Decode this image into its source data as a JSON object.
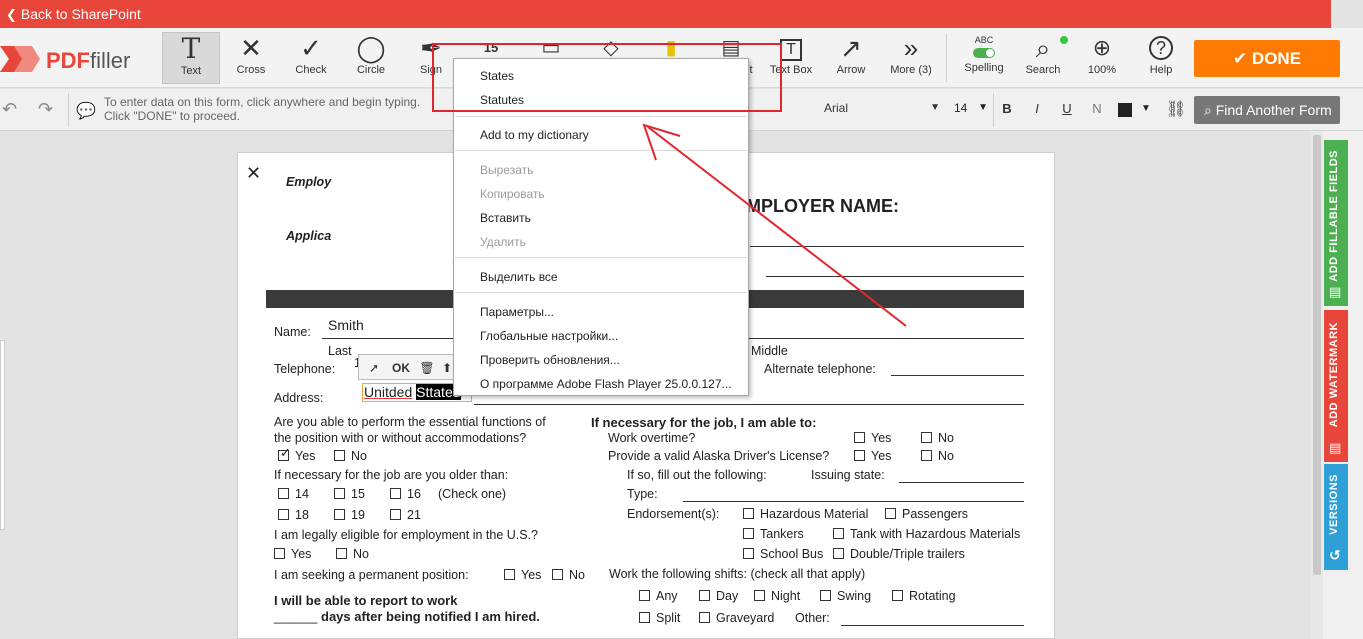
{
  "topbar": {
    "back_label": "Back to SharePoint"
  },
  "logo": {
    "brand_red": "PDF",
    "brand_grey": "filler"
  },
  "toolbar": {
    "tools": [
      {
        "label": "Text",
        "icon": "T"
      },
      {
        "label": "Cross",
        "icon": "✕"
      },
      {
        "label": "Check",
        "icon": "✓"
      },
      {
        "label": "Circle",
        "icon": "◯"
      },
      {
        "label": "Sign",
        "icon": "✒"
      },
      {
        "label": "Text Box",
        "icon": "T"
      },
      {
        "label": "Arrow",
        "icon": "↗"
      },
      {
        "label": "More (3)",
        "icon": "»"
      },
      {
        "label": "Spelling",
        "icon": "ABC"
      },
      {
        "label": "Search",
        "icon": "⌕"
      },
      {
        "label": "100%",
        "icon": "⊕"
      },
      {
        "label": "Help",
        "icon": "?"
      }
    ],
    "partial_label": "t",
    "date_icon": "15",
    "done_label": "DONE"
  },
  "bar2": {
    "hint_line1": "To enter data on this form, click anywhere and begin typing.",
    "hint_line2": "Click \"DONE\" to proceed.",
    "font": "Arial",
    "size": "14",
    "bold": "B",
    "italic": "I",
    "underline": "U",
    "normal": "N",
    "find_label": "Find Another Form"
  },
  "context_menu": {
    "suggestions": [
      "States",
      "Statutes"
    ],
    "add_to_dictionary": "Add to my dictionary",
    "edit_items": [
      {
        "label": "Вырезать",
        "disabled": true
      },
      {
        "label": "Копировать",
        "disabled": true
      },
      {
        "label": "Вставить",
        "disabled": false
      },
      {
        "label": "Удалить",
        "disabled": true
      }
    ],
    "select_all": "Выделить все",
    "flash_items": [
      "Параметры...",
      "Глобальные настройки...",
      "Проверить обновления...",
      "О программе Adobe Flash Player 25.0.0.127..."
    ]
  },
  "mini_toolbar": {
    "ok_label": "OK"
  },
  "address_field": {
    "misspelled": "Unitded",
    "selected": "Sttated"
  },
  "document": {
    "title_line1": "Employ",
    "title_line2": "Applica",
    "employer_name": "EMPLOYER NAME:",
    "name_label": "Name:",
    "name_value": "Smith",
    "last_label": "Last",
    "middle_label": "Middle",
    "telephone_label": "Telephone:",
    "telephone_value": "1",
    "alt_telephone_label": "Alternate telephone:",
    "address_label": "Address:",
    "q_functions_1": "Are you able to perform the essential functions of",
    "q_functions_2": "the position with or without accommodations?",
    "yes": "Yes",
    "no": "No",
    "q_older": "If necessary for the job are you older than:",
    "ages": [
      "14",
      "15",
      "16",
      "18",
      "19",
      "21"
    ],
    "check_one": "(Check one)",
    "q_eligible": "I am legally eligible for employment in the U.S.?",
    "q_permanent": "I am seeking a permanent position:",
    "report_1": "I will be able to report to work",
    "report_2": "days after being notified I am hired.",
    "report_blank": "______",
    "if_necessary": "If necessary for the job, I am able to:",
    "overtime": "Work overtime?",
    "drivers_license": "Provide a valid Alaska Driver's License?",
    "fill_following": "If so, fill out the following:",
    "issuing_state": "Issuing state:",
    "type_label": "Type:",
    "endorsements_label": "Endorsement(s):",
    "endorsements": [
      "Hazardous Material",
      "Passengers",
      "Tankers",
      "Tank with Hazardous Materials",
      "School Bus",
      "Double/Triple trailers"
    ],
    "shifts_label": "Work the following shifts: (check all that apply)",
    "shifts": [
      "Any",
      "Day",
      "Night",
      "Swing",
      "Rotating",
      "Split",
      "Graveyard"
    ],
    "other_label": "Other:"
  },
  "right_tabs": [
    {
      "label": "ADD FILLABLE FIELDS",
      "color": "#4caf50"
    },
    {
      "label": "ADD WATERMARK",
      "color": "#e8463b"
    },
    {
      "label": "VERSIONS",
      "color": "#2f9fd8"
    }
  ]
}
